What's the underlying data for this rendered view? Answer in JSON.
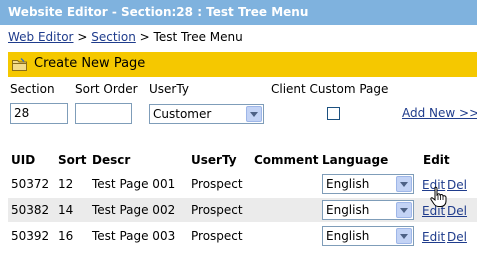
{
  "header": {
    "title": "Website Editor - Section:28 : Test Tree Menu"
  },
  "breadcrumb": {
    "web_editor": "Web Editor",
    "sep1": ">",
    "section": "Section",
    "sep2": ">",
    "current": "Test Tree Menu"
  },
  "toolbar": {
    "create_label": "Create New Page",
    "icon": "folder-icon"
  },
  "form": {
    "section_label": "Section",
    "sort_label": "Sort Order",
    "userty_label": "UserTy",
    "client_label": "Client Custom Page",
    "section_value": "28",
    "sort_value": "",
    "userty_value": "Customer",
    "client_checked": false,
    "add_new": "Add New >>"
  },
  "table": {
    "headers": {
      "uid": "UID",
      "sort": "Sort",
      "descr": "Descr",
      "userty": "UserTy",
      "comment": "Comment",
      "language": "Language",
      "edit": "Edit"
    },
    "rows": [
      {
        "uid": "50372",
        "sort": "12",
        "descr": "Test Page 001",
        "userty": "Prospect",
        "comment": "",
        "language": "English",
        "edit": "Edit",
        "del": "Del"
      },
      {
        "uid": "50382",
        "sort": "14",
        "descr": "Test Page 002",
        "userty": "Prospect",
        "comment": "",
        "language": "English",
        "edit": "Edit",
        "del": "Del"
      },
      {
        "uid": "50392",
        "sort": "16",
        "descr": "Test Page 003",
        "userty": "Prospect",
        "comment": "",
        "language": "English",
        "edit": "Edit",
        "del": "Del"
      }
    ]
  },
  "cursor": "hand-pointer-icon",
  "colors": {
    "title_bar": "#7fb2de",
    "toolbar": "#f5c800",
    "link": "#1f3c8c",
    "row_alt": "#ebebeb"
  }
}
